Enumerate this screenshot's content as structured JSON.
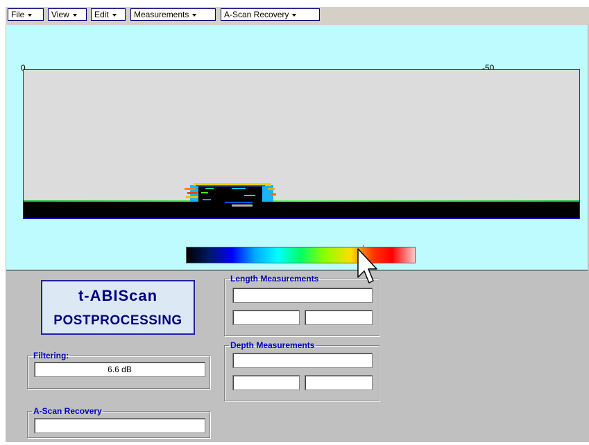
{
  "menu": [
    {
      "label": "File"
    },
    {
      "label": "View"
    },
    {
      "label": "Edit"
    },
    {
      "label": "Measurements"
    },
    {
      "label": "A-Scan Recovery"
    }
  ],
  "axis": {
    "tick_left": "0",
    "tick_right": "-50"
  },
  "logo": {
    "line1": "t-ABIScan",
    "line2": "POSTPROCESSING"
  },
  "filtering": {
    "legend": "Filtering:",
    "value": "6.6 dB"
  },
  "ascan_recovery": {
    "legend": "A-Scan Recovery",
    "value": ""
  },
  "length_measurements": {
    "legend": "Length Measurements",
    "main": "",
    "left": "",
    "right": ""
  },
  "depth_measurements": {
    "legend": "Depth Measurements",
    "main": "",
    "left": "",
    "right": ""
  },
  "colors": {
    "view_background": "#bdfbff",
    "plot_background": "#dcdcdc",
    "legend_text": "#0000c0"
  },
  "icons": {
    "dropdown": "chevron-down-icon",
    "cursor": "mouse-pointer-icon"
  }
}
